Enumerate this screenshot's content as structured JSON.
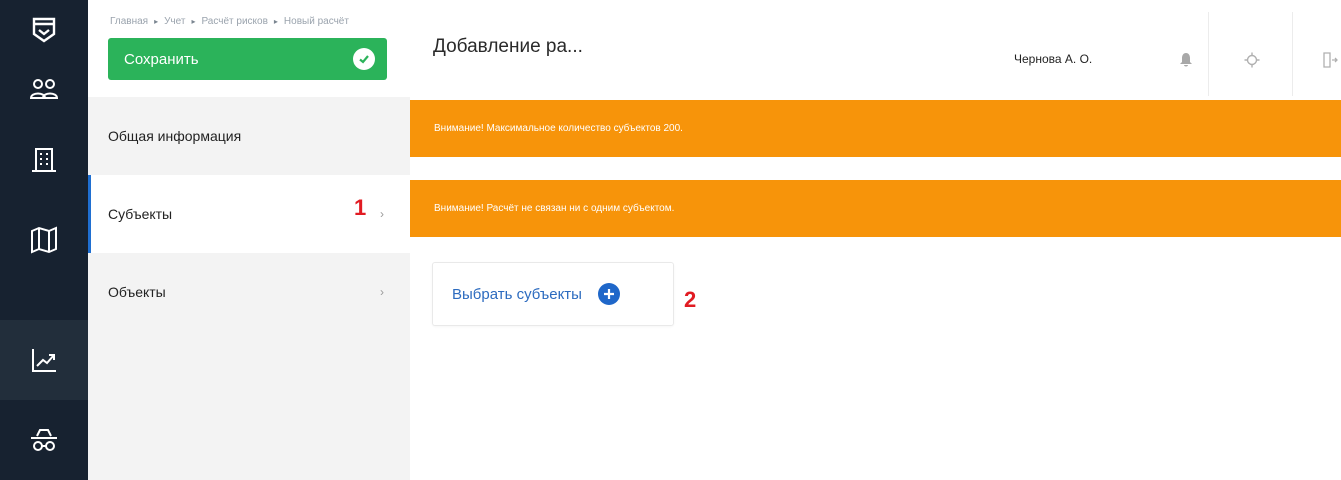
{
  "breadcrumb": [
    "Главная",
    "Учет",
    "Расчёт рисков",
    "Новый расчёт"
  ],
  "breadcrumb_separator": "▸",
  "header": {
    "save_label": "Сохранить",
    "title": "Добавление ра...",
    "user": "Чернова А. О."
  },
  "rail": {
    "icons": [
      "logo-shield-icon",
      "users-icon",
      "building-icon",
      "map-icon",
      "chart-trend-icon",
      "spy-icon"
    ]
  },
  "menu": {
    "items": [
      {
        "label": "Общая информация",
        "chevron": ""
      },
      {
        "label": "Субъекты",
        "chevron": "›"
      },
      {
        "label": "Объекты",
        "chevron": "›"
      }
    ]
  },
  "alerts": [
    "Внимание! Максимальное количество субъектов 200.",
    "Внимание! Расчёт не связан ни с одним субъектом."
  ],
  "select_subjects_label": "Выбрать субъекты",
  "annotations": [
    "1",
    "2"
  ],
  "colors": {
    "rail": "#172230",
    "save": "#2bb35a",
    "alert": "#f7940a",
    "link": "#2c6bbf",
    "accent": "#1f6fd1",
    "annotation": "#e11b22"
  }
}
